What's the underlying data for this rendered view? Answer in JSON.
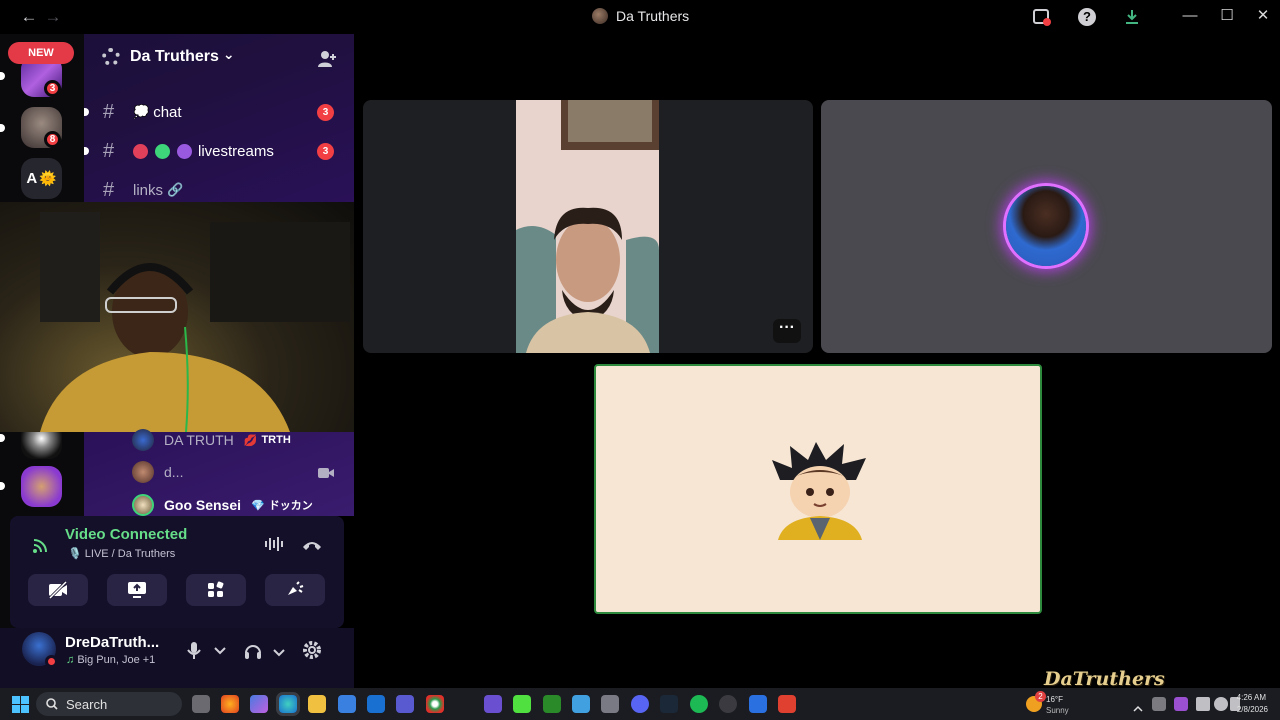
{
  "window": {
    "title": "Da Truthers",
    "back_glyph": "←",
    "forward_glyph": "→",
    "minimize_glyph": "—",
    "maximize_glyph": "☐",
    "close_glyph": "✕",
    "help_glyph": "?"
  },
  "rail": {
    "new_badge": "NEW",
    "servers": [
      {
        "mentions": "3"
      },
      {
        "mentions": "8"
      },
      {
        "initial": "A",
        "emoji": "🌞"
      }
    ]
  },
  "guild": {
    "name": "Da Truthers",
    "chevron": "⌄",
    "channels": [
      {
        "hash": "#",
        "emoji": "💭",
        "name": "chat",
        "badge": "3"
      },
      {
        "hash": "#",
        "name": "livestreams",
        "badge": "3"
      },
      {
        "hash": "#",
        "name": "links",
        "emoji": "🔗"
      }
    ]
  },
  "voice_members": [
    {
      "name": "DA TRUTH",
      "tag_emoji": "💋",
      "tag": "TRTH"
    },
    {
      "name": "d..."
    },
    {
      "name": "Goo Sensei",
      "tag_emoji": "💎",
      "tag": "ドッカン"
    }
  ],
  "voice_panel": {
    "status": "Video Connected",
    "channel": "LIVE / Da Truthers"
  },
  "user": {
    "name": "DreDaTruth...",
    "activity": "Big Pun, Joe +1",
    "music_glyph": "♫"
  },
  "stage": {
    "more_glyph": "···",
    "watermark": "DaTruthers"
  },
  "taskbar": {
    "search_placeholder": "Search",
    "weather_temp": "16°F",
    "weather_cond": "Sunny",
    "time": "4:26 AM",
    "date": "2/8/2026",
    "weather_badge": "2"
  },
  "colors": {
    "accent_green": "#66dd88",
    "mention_red": "#f23f43",
    "panel_purple": "#2a1158"
  }
}
